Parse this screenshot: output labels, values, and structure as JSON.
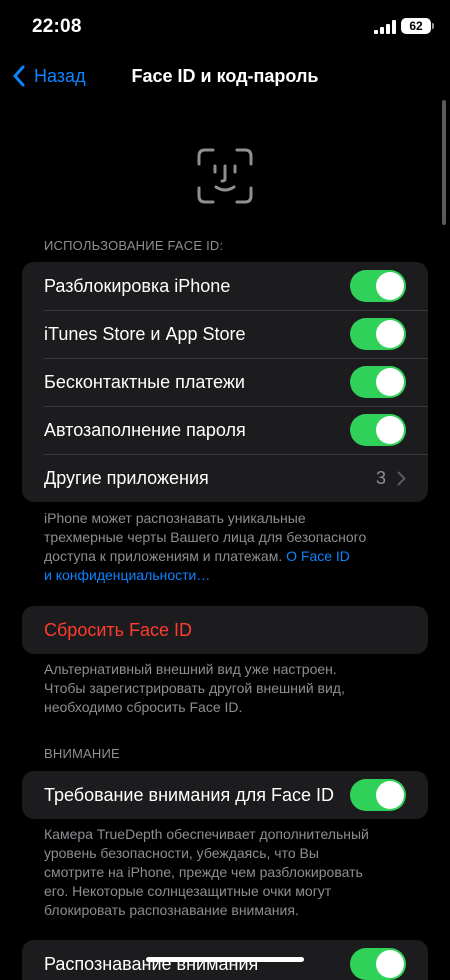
{
  "status": {
    "time": "22:08",
    "battery": "62"
  },
  "nav": {
    "back_label": "Назад",
    "title": "Face ID и код-пароль"
  },
  "faceid_section": {
    "header": "ИСПОЛЬЗОВАНИЕ FACE ID:",
    "rows": [
      {
        "label": "Разблокировка iPhone",
        "on": true
      },
      {
        "label": "iTunes Store и App Store",
        "on": true
      },
      {
        "label": "Бесконтактные платежи",
        "on": true
      },
      {
        "label": "Автозаполнение пароля",
        "on": true
      }
    ],
    "other_apps": {
      "label": "Другие приложения",
      "value": "3"
    },
    "footer_line1": "iPhone может распознавать уникальные",
    "footer_line2": "трехмерные черты Вашего лица для безопасного",
    "footer_line3": "доступа к приложениям и платежам.",
    "footer_link1": "О Face ID",
    "footer_link2": "и конфиденциальности…"
  },
  "reset": {
    "label": "Сбросить Face ID",
    "note_line1": "Альтернативный внешний вид уже настроен.",
    "note_line2": "Чтобы зарегистрировать другой внешний вид,",
    "note_line3": "необходимо сбросить Face ID."
  },
  "attention": {
    "header": "ВНИМАНИЕ",
    "require_label": "Требование внимания для Face ID",
    "require_on": true,
    "note_line1": "Камера TrueDepth обеспечивает дополнительный",
    "note_line2": "уровень безопасности, убеждаясь, что Вы",
    "note_line3": "смотрите на iPhone, прежде чем разблокировать",
    "note_line4": "его. Некоторые солнцезащитные очки могут",
    "note_line5": "блокировать распознавание внимания.",
    "aware_label": "Распознавание внимания",
    "aware_on": true
  },
  "colors": {
    "accent": "#0a84ff",
    "toggle_on": "#30d158",
    "destructive": "#ff3b30",
    "cell": "#1c1c1e"
  },
  "icons": [
    "back-chevron-icon",
    "face-id-icon",
    "chevron-right-icon",
    "signal-icon",
    "battery-icon"
  ]
}
